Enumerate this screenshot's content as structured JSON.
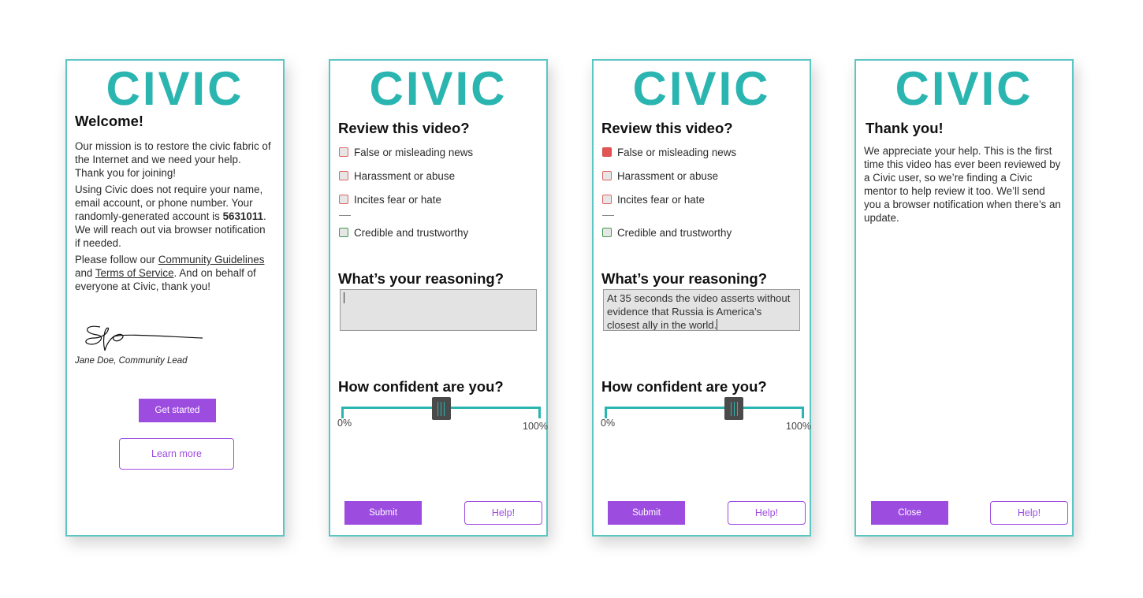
{
  "brand": {
    "logo_text": "CIVIC",
    "color": "#2bb5b0"
  },
  "welcome": {
    "title": "Welcome!",
    "p1": "Our mission is to restore the civic fabric of the Internet and we need your help. Thank you for joining!",
    "p2_pre": "Using Civic does not require your name, email account, or phone number. Your randomly-generated account is ",
    "account_id": "5631011",
    "p2_post": ". We will reach out via browser notification if needed.",
    "p3_pre": "Please follow our ",
    "community_guidelines": "Community Guidelines",
    "p3_and": " and ",
    "terms": "Terms of Service",
    "p3_post": ". And on behalf of everyone at Civic, thank you!",
    "signature_caption": "Jane Doe, Community Lead",
    "get_started": "Get started",
    "learn_more": "Learn more"
  },
  "review": {
    "title": "Review this video?",
    "options": [
      "False or misleading news",
      "Harassment or abuse",
      "Incites fear or hate",
      "Credible and trustworthy"
    ],
    "reasoning_title": "What’s your reasoning?",
    "confidence_title": "How confident are you?",
    "min_label": "0%",
    "max_label": "100%",
    "submit": "Submit",
    "help": "Help!"
  },
  "screen2": {
    "reasoning_text": "",
    "confidence": 0.5,
    "checked": []
  },
  "screen3": {
    "reasoning_text": "At 35 seconds the video asserts without evidence that Russia is America’s closest ally in the world.",
    "confidence": 0.65,
    "checked": [
      "False or misleading news"
    ]
  },
  "thanks": {
    "title": "Thank you!",
    "message": "We appreciate your help. This is the first time this video has ever been reviewed by a Civic user, so we’re finding a Civic mentor to help review it too. We’ll send you a browser notification when there’s an update.",
    "close": "Close",
    "help": "Help!"
  },
  "colors": {
    "accent": "#9d4ce0",
    "teal": "#2bb5b0",
    "flag": "#e25555",
    "credible": "#3f9a4f"
  }
}
